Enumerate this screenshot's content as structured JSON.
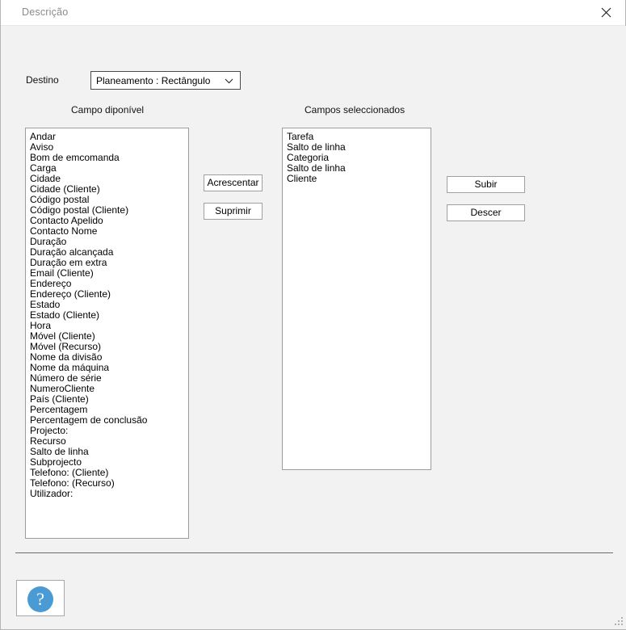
{
  "window": {
    "title": "Descrição",
    "close_icon": "close-icon"
  },
  "form": {
    "destino_label": "Destino",
    "destino_value": "Planeamento : Rectângulo",
    "chevron_icon": "chevron-down-icon"
  },
  "headers": {
    "available": "Campo diponível",
    "selected": "Campos seleccionados"
  },
  "available_fields": [
    "Andar",
    "Aviso",
    "Bom de emcomanda",
    "Carga",
    "Cidade",
    "Cidade (Cliente)",
    "Código postal",
    "Código postal (Cliente)",
    "Contacto Apelido",
    "Contacto Nome",
    "Duração",
    "Duração alcançada",
    "Duração em extra",
    "Email (Cliente)",
    "Endereço",
    "Endereço (Cliente)",
    "Estado",
    "Estado (Cliente)",
    "Hora",
    "Móvel (Cliente)",
    "Móvel (Recurso)",
    "Nome da divisão",
    "Nome da máquina",
    "Número de série",
    "NumeroCliente",
    "País (Cliente)",
    "Percentagem",
    "Percentagem de conclusão",
    "Projecto:",
    "Recurso",
    "Salto de linha",
    "Subprojecto",
    "Telefono: (Cliente)",
    "Telefono: (Recurso)",
    "Utilizador:"
  ],
  "selected_fields": [
    "Tarefa",
    "Salto de linha",
    "Categoria",
    "Salto de linha",
    "Cliente"
  ],
  "buttons": {
    "add": "Acrescentar",
    "remove": "Suprimir",
    "up": "Subir",
    "down": "Descer"
  },
  "help": {
    "glyph": "?",
    "icon": "help-question-icon"
  },
  "colors": {
    "dialog_background": "#f2f2f2",
    "titlebar_background": "#ffffff",
    "title_text": "#8a8a8a",
    "listbox_background": "#ffffff",
    "listbox_border": "#9d9d9d",
    "button_border": "#a0a0a0",
    "separator": "#6d6d6d",
    "help_circle": "#4a9bd4"
  }
}
